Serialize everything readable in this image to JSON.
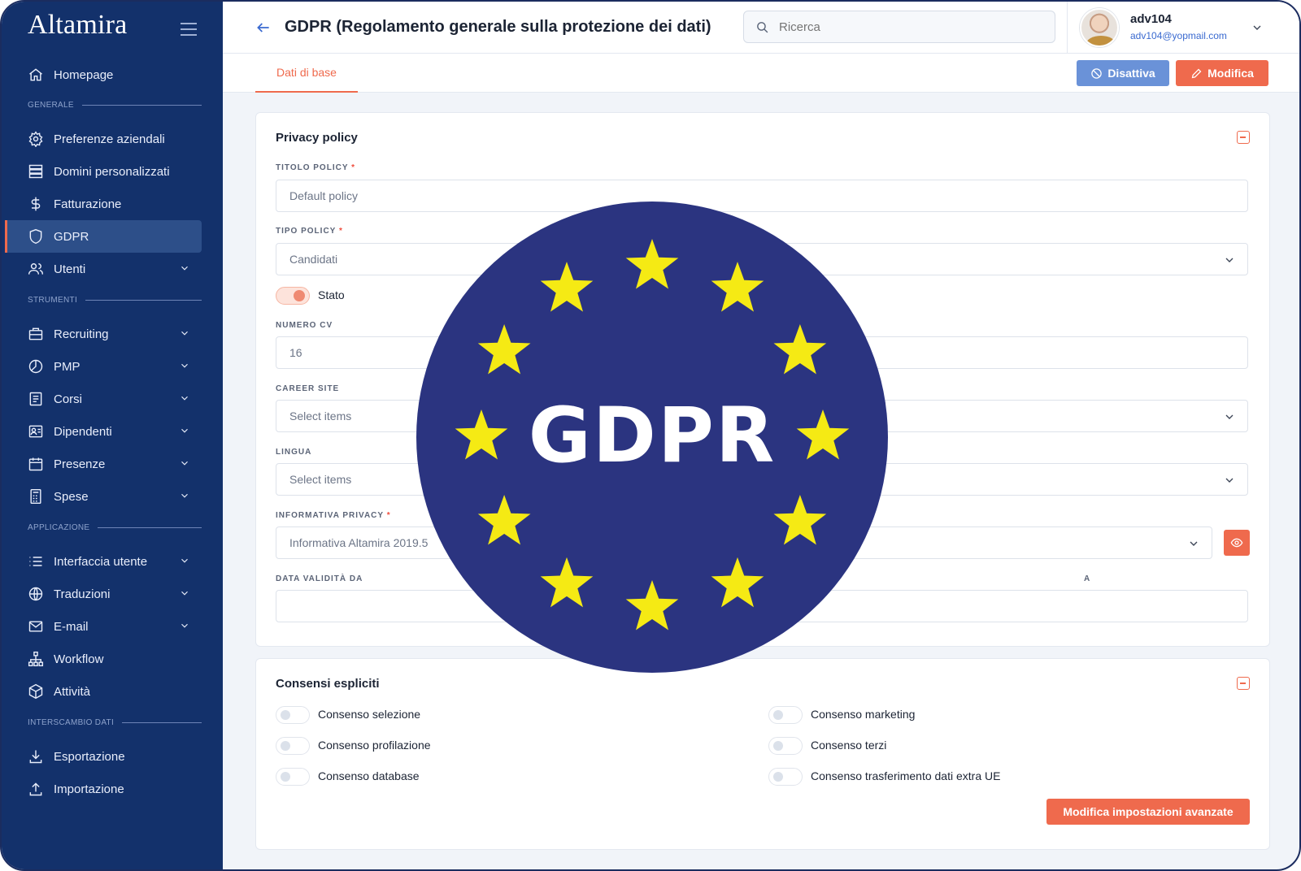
{
  "app": {
    "logo": "Altamira"
  },
  "sidebar": {
    "items": [
      {
        "label": "Homepage",
        "icon": "home-icon"
      },
      {
        "section": "GENERALE"
      },
      {
        "label": "Preferenze aziendali",
        "icon": "gear-icon"
      },
      {
        "label": "Domini personalizzati",
        "icon": "server-icon"
      },
      {
        "label": "Fatturazione",
        "icon": "dollar-icon"
      },
      {
        "label": "GDPR",
        "icon": "shield-icon",
        "active": true
      },
      {
        "label": "Utenti",
        "icon": "users-icon",
        "expandable": true
      },
      {
        "section": "STRUMENTI"
      },
      {
        "label": "Recruiting",
        "icon": "briefcase-icon",
        "expandable": true
      },
      {
        "label": "PMP",
        "icon": "pie-chart-icon",
        "expandable": true
      },
      {
        "label": "Corsi",
        "icon": "document-icon",
        "expandable": true
      },
      {
        "label": "Dipendenti",
        "icon": "id-card-icon",
        "expandable": true
      },
      {
        "label": "Presenze",
        "icon": "calendar-icon",
        "expandable": true
      },
      {
        "label": "Spese",
        "icon": "calculator-icon",
        "expandable": true
      },
      {
        "section": "APPLICAZIONE"
      },
      {
        "label": "Interfaccia utente",
        "icon": "list-icon",
        "expandable": true
      },
      {
        "label": "Traduzioni",
        "icon": "globe-icon",
        "expandable": true
      },
      {
        "label": "E-mail",
        "icon": "mail-icon",
        "expandable": true
      },
      {
        "label": "Workflow",
        "icon": "sitemap-icon"
      },
      {
        "label": "Attività",
        "icon": "cube-icon"
      },
      {
        "section": "INTERSCAMBIO DATI"
      },
      {
        "label": "Esportazione",
        "icon": "download-icon"
      },
      {
        "label": "Importazione",
        "icon": "upload-icon"
      }
    ]
  },
  "header": {
    "title": "GDPR (Regolamento generale sulla protezione dei dati)",
    "search_placeholder": "Ricerca",
    "user": {
      "name": "adv104",
      "email": "adv104@yopmail.com"
    }
  },
  "tabs": {
    "active": "Dati di base"
  },
  "actions": {
    "deactivate": "Disattiva",
    "edit": "Modifica"
  },
  "privacy_policy": {
    "title": "Privacy policy",
    "fields": {
      "titolo_label": "TITOLO POLICY",
      "titolo_value": "Default policy",
      "tipo_label": "TIPO POLICY",
      "tipo_value": "Candidati",
      "stato_label": "Stato",
      "numero_cv_label": "NUMERO CV",
      "numero_cv_value": "16",
      "career_site_label": "CAREER SITE",
      "career_site_placeholder": "Select items",
      "lingua_label": "LINGUA",
      "lingua_placeholder": "Select items",
      "informativa_label": "INFORMATIVA PRIVACY",
      "informativa_value": "Informativa Altamira 2019.5",
      "data_validita_label": "DATA VALIDITÀ DA",
      "data_validita_a_partial": "A",
      "required_mark": "*"
    }
  },
  "consensi": {
    "title": "Consensi espliciti",
    "left": [
      "Consenso selezione",
      "Consenso profilazione",
      "Consenso database"
    ],
    "right": [
      "Consenso marketing",
      "Consenso terzi",
      "Consenso trasferimento dati extra UE"
    ],
    "advanced_button": "Modifica impostazioni avanzate"
  },
  "emblem": {
    "text": "GDPR",
    "star_count": 12,
    "background": "#2b3480",
    "star_color": "#f5ea14"
  },
  "colors": {
    "sidebar": "#13316b",
    "accent": "#ef6a4d",
    "secondary": "#6a92d8",
    "link": "#3a6ad0"
  }
}
